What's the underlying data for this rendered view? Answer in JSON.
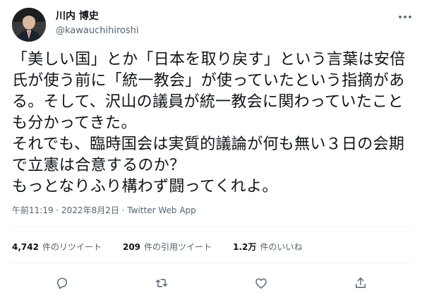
{
  "author": {
    "display_name": "川内 博史",
    "handle": "@kawauchihiroshi"
  },
  "tweet_text": "「美しい国」とか「日本を取り戻す」という言葉は安倍氏が使う前に「統一教会」が使っていたという指摘がある。そして、沢山の議員が統一教会に関わっていたことも分かってきた。\nそれでも、臨時国会は実質的議論が何も無い３日の会期で立憲は合意するのか？\nもっとなりふり構わず闘ってくれよ。",
  "meta": {
    "time": "午前11:19",
    "separator": " · ",
    "date": "2022年8月2日",
    "source": "Twitter Web App"
  },
  "stats": [
    {
      "count": "4,742",
      "label": "件のリツイート"
    },
    {
      "count": "209",
      "label": "件の引用ツイート"
    },
    {
      "count": "1.2万",
      "label": "件のいいね"
    }
  ],
  "actions": [
    {
      "icon": "reply-icon"
    },
    {
      "icon": "retweet-icon"
    },
    {
      "icon": "like-icon"
    },
    {
      "icon": "share-icon"
    }
  ],
  "colors": {
    "text": "#0f1419",
    "secondary": "#536471",
    "divider": "#eff3f4"
  }
}
